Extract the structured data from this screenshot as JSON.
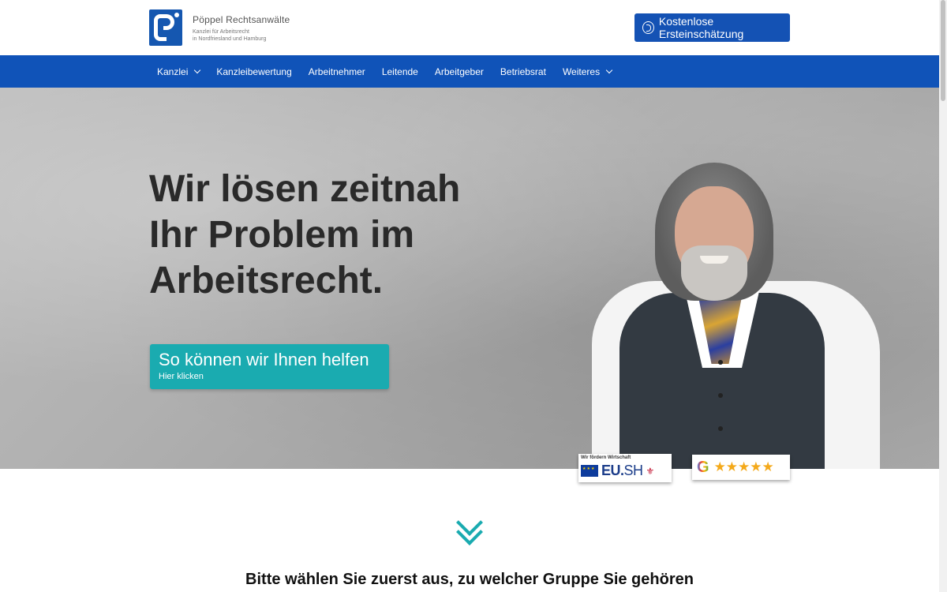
{
  "header": {
    "logo_title": "Pöppel Rechtsanwälte",
    "logo_sub1": "Kanzlei für Arbeitsrecht",
    "logo_sub2": "in Nordfriesland und Hamburg",
    "cta_label": "Kostenlose Ersteinschätzung"
  },
  "nav": {
    "items": [
      "Kanzlei",
      "Kanzleibewertung",
      "Arbeitnehmer",
      "Leitende",
      "Arbeitgeber",
      "Betriebsrat",
      "Weiteres"
    ]
  },
  "hero": {
    "title_line1": "Wir lösen zeitnah",
    "title_line2": "Ihr Problem im",
    "title_line3": "Arbeitsrecht.",
    "button_main": "So können wir Ihnen helfen",
    "button_sub": "Hier klicken"
  },
  "badges": {
    "eu_small": "Wir fördern Wirtschaft",
    "eu_name_bold": "EU.",
    "eu_name_light": "SH",
    "google_letter": "G",
    "google_stars": "★★★★★"
  },
  "section": {
    "title": "Bitte wählen Sie zuerst aus, zu welcher Gruppe Sie gehören"
  },
  "colors": {
    "brand_blue": "#1053b8",
    "accent_teal": "#1aabb0"
  }
}
